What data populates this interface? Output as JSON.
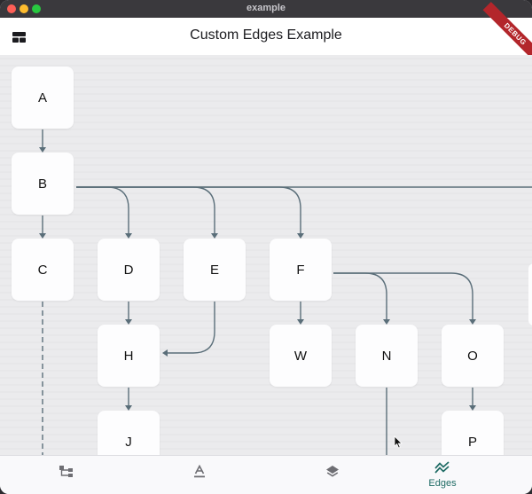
{
  "window": {
    "title": "example"
  },
  "appbar": {
    "title": "Custom Edges Example",
    "debug_label": "DEBUG"
  },
  "graph": {
    "nodes": [
      "A",
      "B",
      "C",
      "D",
      "E",
      "F",
      "H",
      "W",
      "N",
      "O",
      "J",
      "P"
    ],
    "edge_color": "#5a6e79"
  },
  "bottom_nav": {
    "items": [
      {
        "icon": "tree-icon",
        "label": ""
      },
      {
        "icon": "text-format-icon",
        "label": ""
      },
      {
        "icon": "layers-icon",
        "label": ""
      },
      {
        "icon": "edges-icon",
        "label": "Edges",
        "active": true
      }
    ],
    "active_color": "#1e6b64"
  }
}
